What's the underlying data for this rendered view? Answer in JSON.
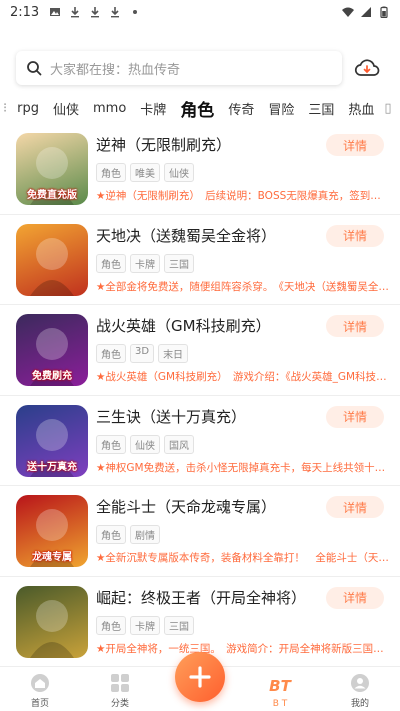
{
  "status": {
    "time": "2:13"
  },
  "search": {
    "placeholder": "大家都在搜：热血传奇"
  },
  "categories": [
    "rpg",
    "仙侠",
    "mmo",
    "卡牌",
    "角色",
    "传奇",
    "冒险",
    "三国",
    "热血"
  ],
  "active_category": "角色",
  "detail_label": "详情",
  "games": [
    {
      "title": "逆神（无限制刷充）",
      "tags": [
        "角色",
        "唯美",
        "仙侠"
      ],
      "desc": "★逆神（无限制刷充）　后续说明：BOSS无限爆真充，签到无限送",
      "thumb_colors": [
        "#f4d7a8",
        "#5a8a4a"
      ],
      "badge": "免费直充版"
    },
    {
      "title": "天地决（送魏蜀吴全金将）",
      "tags": [
        "角色",
        "卡牌",
        "三国"
      ],
      "desc": "★全部金将免费送，随便组阵容杀穿。　《天地决（送魏蜀吴全金将）》",
      "thumb_colors": [
        "#f2a533",
        "#c0311e"
      ],
      "badge": ""
    },
    {
      "title": "战火英雄（GM科技刷充）",
      "tags": [
        "角色",
        "3D",
        "末日"
      ],
      "desc": "★战火英雄（GM科技刷充）　游戏介绍：《战火英雄_GM科技刷充》",
      "thumb_colors": [
        "#3b2a5c",
        "#8b1e9a"
      ],
      "badge": "免费刷充"
    },
    {
      "title": "三生诀（送十万真充）",
      "tags": [
        "角色",
        "仙侠",
        "国风"
      ],
      "desc": "★神权GM免费送，击杀小怪无限掉真充卡，每天上线共领十万真充",
      "thumb_colors": [
        "#2a3f8a",
        "#7f3fbf"
      ],
      "badge": "送十万真充"
    },
    {
      "title": "全能斗士（天命龙魂专属）",
      "tags": [
        "角色",
        "剧情"
      ],
      "desc": "★全新沉默专属版本传奇，装备材料全靠打！　全能斗士（天命龙魂专属）",
      "thumb_colors": [
        "#b8141a",
        "#f0a530"
      ],
      "badge": "龙魂专属"
    },
    {
      "title": "崛起：终极王者（开局全神将）",
      "tags": [
        "角色",
        "卡牌",
        "三国"
      ],
      "desc": "★开局全神将，一统三国。　游戏简介：开局全神将新版三国卡牌",
      "thumb_colors": [
        "#4a5a2a",
        "#c9a23a"
      ],
      "badge": ""
    }
  ],
  "nav": [
    {
      "label": "首页",
      "icon": "home-icon"
    },
    {
      "label": "分类",
      "icon": "grid-icon"
    },
    {
      "label": "",
      "icon": "add-icon"
    },
    {
      "label": "B T",
      "icon": "bt-icon"
    },
    {
      "label": "我的",
      "icon": "user-icon"
    }
  ],
  "nav_bt_mark": "BT",
  "colors": {
    "accent": "#ff7c4a",
    "detail_bg": "#ffeee6"
  }
}
